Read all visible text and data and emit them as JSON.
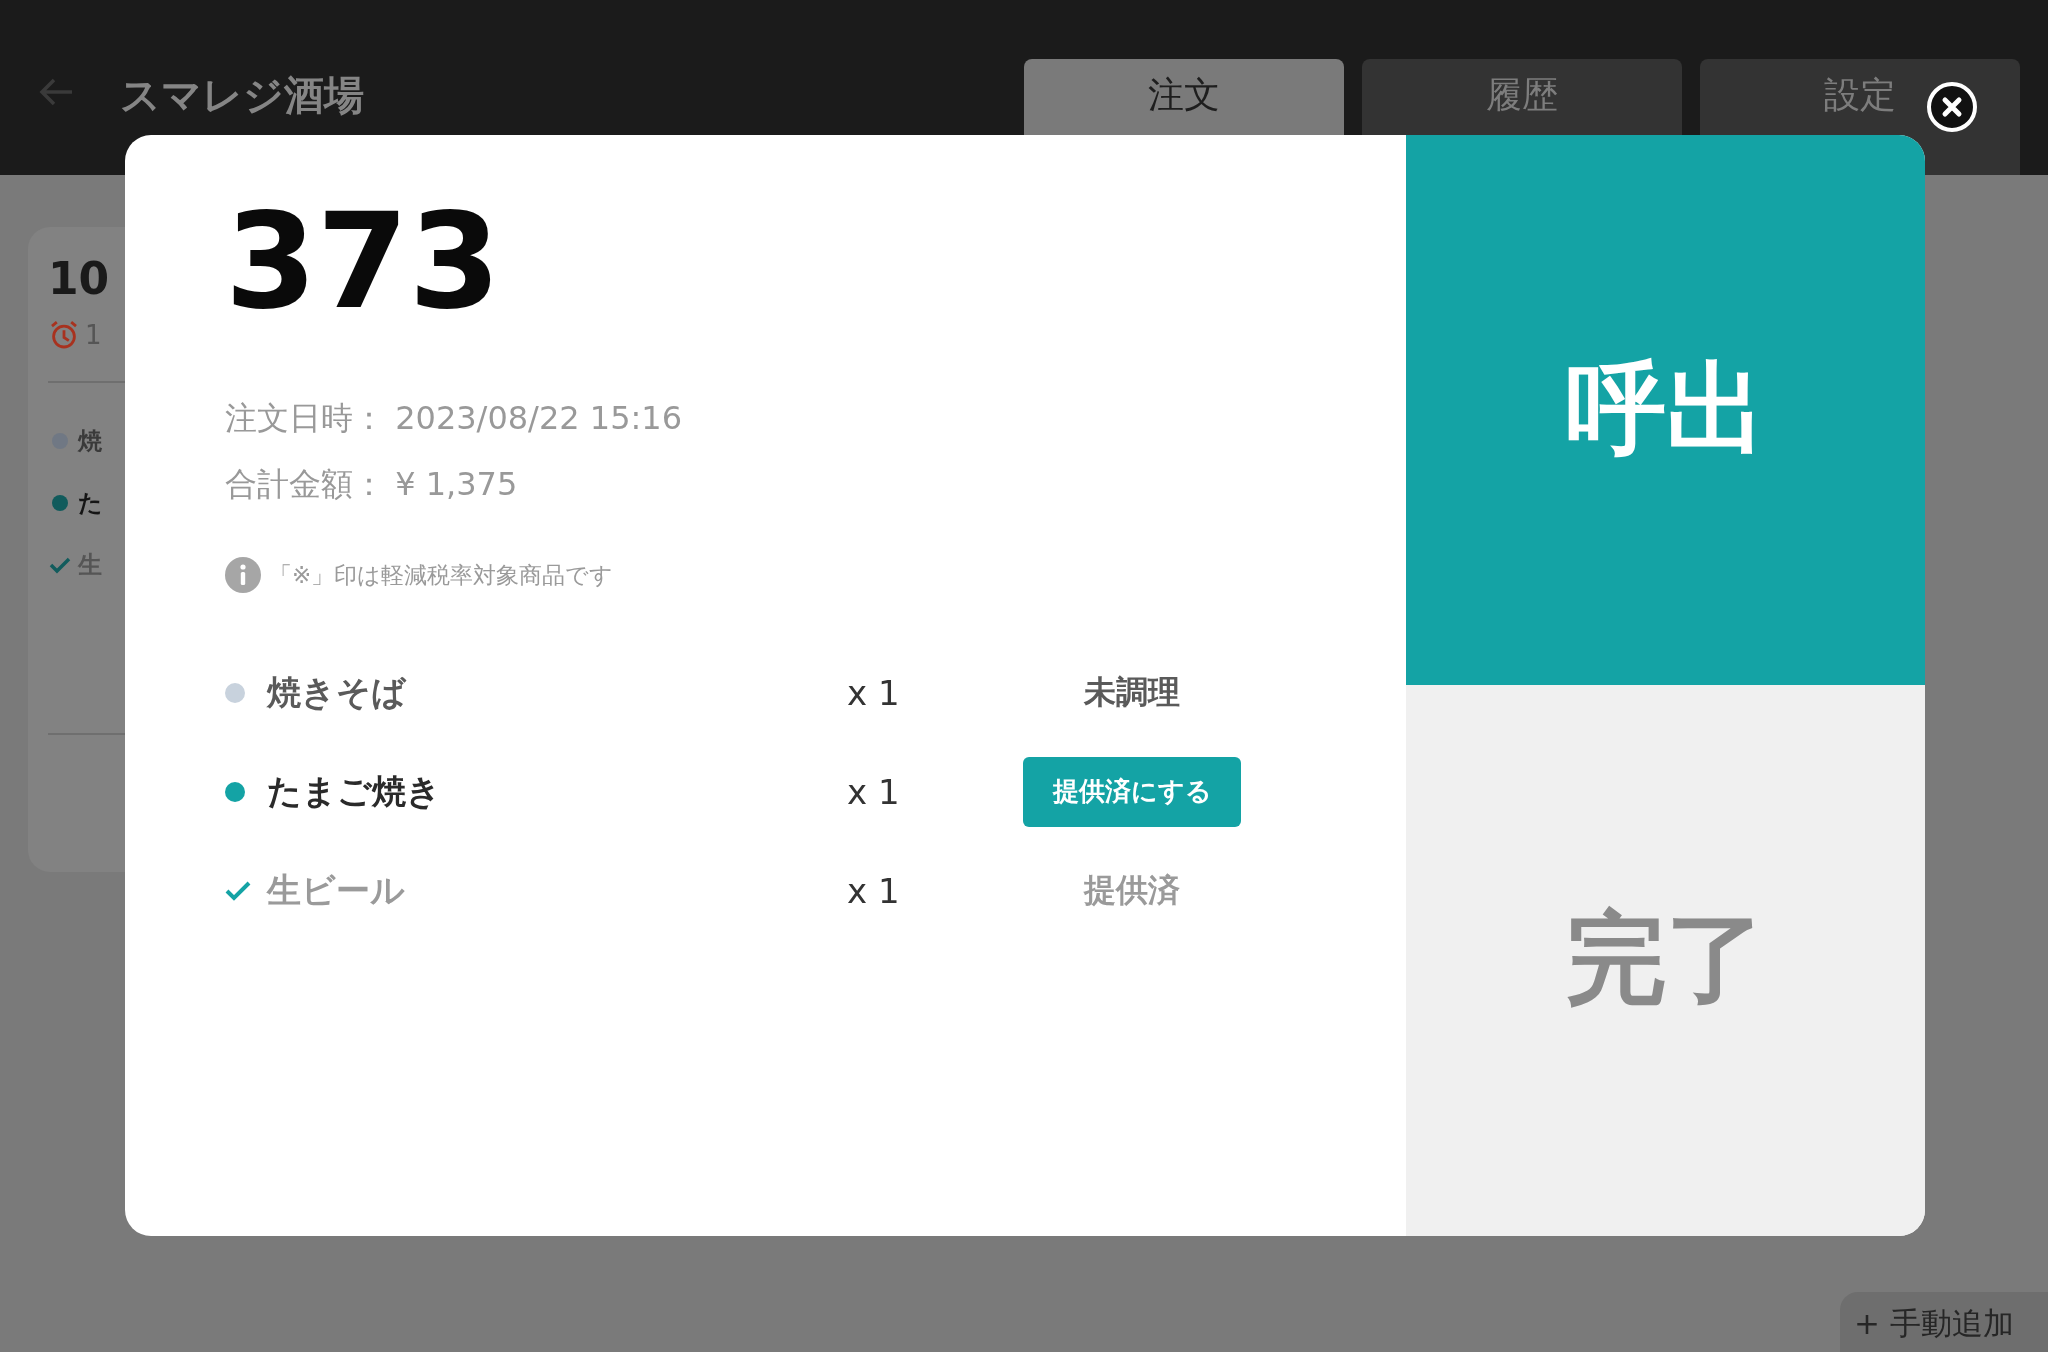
{
  "header": {
    "title": "スマレジ酒場",
    "tabs": [
      {
        "label": "注文",
        "selected": true
      },
      {
        "label": "履歴",
        "selected": false
      },
      {
        "label": "設定",
        "selected": false
      }
    ]
  },
  "background_card": {
    "number": "10",
    "time": "1",
    "items": [
      {
        "kind": "pending",
        "name": "焼"
      },
      {
        "kind": "ready",
        "name": "た"
      },
      {
        "kind": "served",
        "name": "生"
      }
    ]
  },
  "add_button": {
    "icon": "+",
    "label": "手動追加"
  },
  "modal": {
    "order_number": "373",
    "order_date_label": "注文日時：",
    "order_date": "2023/08/22 15:16",
    "total_label": "合計金額：",
    "total": "¥ 1,375",
    "note": "「※」印は軽減税率対象商品です",
    "items": [
      {
        "kind": "pending",
        "name": "焼きそば",
        "quantity": "x 1",
        "status": "未調理"
      },
      {
        "kind": "ready",
        "name": "たまご焼き",
        "quantity": "x 1",
        "status": "提供済にする"
      },
      {
        "kind": "served",
        "name": "生ビール",
        "quantity": "x 1",
        "status": "提供済"
      }
    ],
    "call_button": "呼出",
    "complete_button": "完了"
  }
}
